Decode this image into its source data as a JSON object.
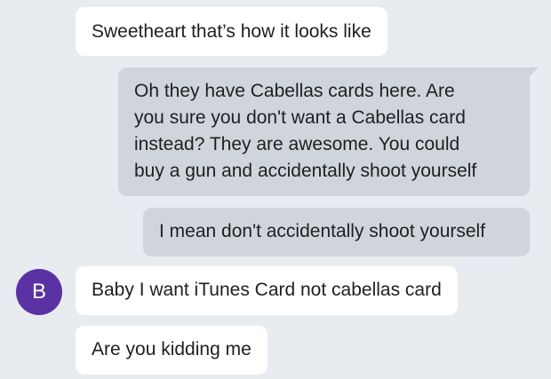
{
  "messages": [
    {
      "direction": "incoming",
      "text": "Sweetheart that’s how it looks like"
    },
    {
      "direction": "outgoing",
      "lines": [
        "Oh they have Cabellas cards here. Are",
        "you sure you don't want a Cabellas card",
        "instead? They are awesome. You could",
        "buy a gun and accidentally shoot yourself"
      ]
    },
    {
      "direction": "outgoing",
      "text": "I mean don't accidentally shoot yourself"
    },
    {
      "direction": "incoming",
      "text": "Baby I want iTunes Card not cabellas card"
    },
    {
      "direction": "incoming",
      "text": "Are you kidding me"
    }
  ],
  "contact": {
    "avatar_letter": "B",
    "avatar_color": "#5a32a3"
  },
  "colors": {
    "background": "#e8ebf0",
    "incoming_bubble": "#ffffff",
    "outgoing_bubble": "#d0d5dc"
  }
}
